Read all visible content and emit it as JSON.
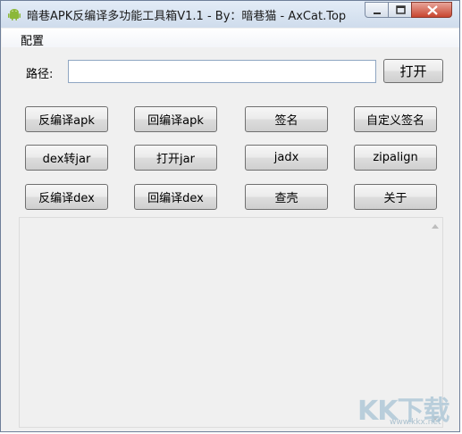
{
  "window": {
    "title": "暗巷APK反编译多功能工具箱V1.1 - By：暗巷猫 - AxCat.Top",
    "icon": "android-icon"
  },
  "menu": {
    "items": [
      "配置"
    ]
  },
  "path": {
    "label": "路径:",
    "value": "",
    "open_label": "打开"
  },
  "buttons": [
    [
      "反编译apk",
      "回编译apk",
      "签名",
      "自定义签名"
    ],
    [
      "dex转jar",
      "打开jar",
      "jadx",
      "zipalign"
    ],
    [
      "反编译dex",
      "回编译dex",
      "查壳",
      "关于"
    ]
  ],
  "output": {
    "text": ""
  },
  "watermark": {
    "text": "KK下载",
    "url": "www.kkx.net"
  },
  "colors": {
    "title_bar": "#dbe6f3",
    "close_button": "#c8452f",
    "input_border": "#8fa6c2"
  }
}
